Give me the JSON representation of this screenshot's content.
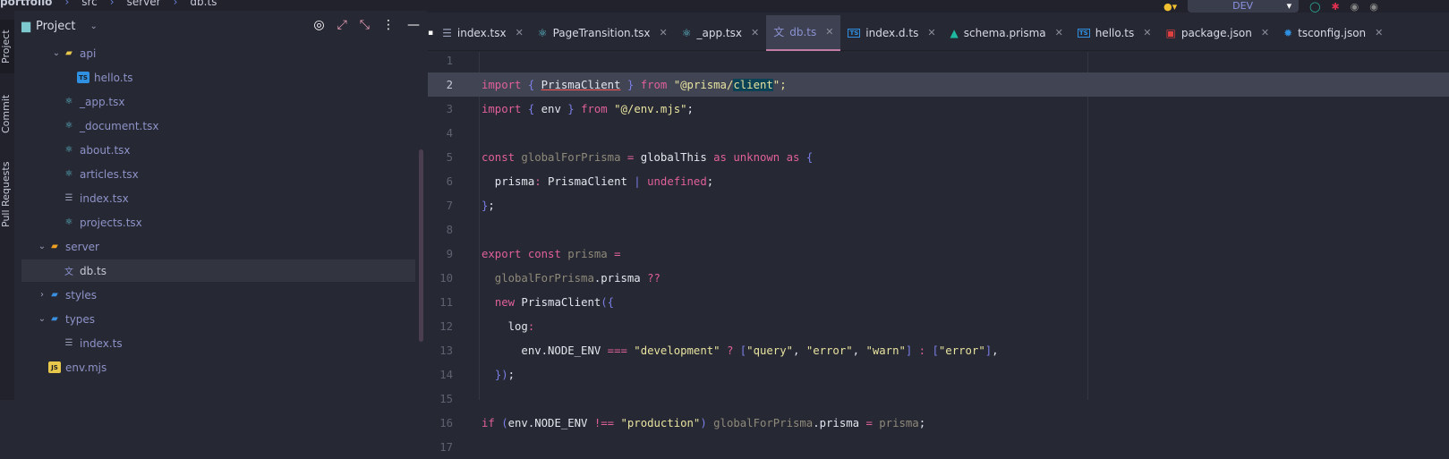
{
  "breadcrumb": [
    "portfolio",
    "src",
    "server",
    "db.ts"
  ],
  "toolbar": {
    "run_config": "DEV"
  },
  "vertical_tabs": [
    "Project",
    "Commit",
    "Pull Requests"
  ],
  "project": {
    "title": "Project",
    "tree": [
      {
        "label": "api",
        "type": "folder",
        "depth": 2,
        "open": true,
        "icon": "folder-api-icon",
        "color": "#e8c84a"
      },
      {
        "label": "hello.ts",
        "type": "file",
        "depth": 3,
        "icon": "typescript-icon",
        "color": "#2f8fe0"
      },
      {
        "label": "_app.tsx",
        "type": "file",
        "depth": 2,
        "icon": "react-icon",
        "color": "#5fc3d6"
      },
      {
        "label": "_document.tsx",
        "type": "file",
        "depth": 2,
        "icon": "react-icon",
        "color": "#5fc3d6"
      },
      {
        "label": "about.tsx",
        "type": "file",
        "depth": 2,
        "icon": "react-icon",
        "color": "#5fc3d6"
      },
      {
        "label": "articles.tsx",
        "type": "file",
        "depth": 2,
        "icon": "react-icon",
        "color": "#5fc3d6"
      },
      {
        "label": "index.tsx",
        "type": "file",
        "depth": 2,
        "icon": "list-icon",
        "color": "#9aa0b8"
      },
      {
        "label": "projects.tsx",
        "type": "file",
        "depth": 2,
        "icon": "react-icon",
        "color": "#5fc3d6"
      },
      {
        "label": "server",
        "type": "folder",
        "depth": 1,
        "open": true,
        "icon": "folder-server-icon",
        "color": "#f0a020"
      },
      {
        "label": "db.ts",
        "type": "file",
        "depth": 2,
        "icon": "translate-icon",
        "color": "#8b92d0",
        "selected": true
      },
      {
        "label": "styles",
        "type": "folder",
        "depth": 1,
        "open": false,
        "icon": "folder-styles-icon",
        "color": "#3a8fe0"
      },
      {
        "label": "types",
        "type": "folder",
        "depth": 1,
        "open": true,
        "icon": "folder-types-icon",
        "color": "#3a8fe0"
      },
      {
        "label": "index.ts",
        "type": "file",
        "depth": 2,
        "icon": "list-icon",
        "color": "#9aa0b8"
      },
      {
        "label": "env.mjs",
        "type": "file",
        "depth": 1,
        "icon": "javascript-icon",
        "color": "#e8c84a"
      }
    ]
  },
  "tabs": [
    {
      "label": "index.tsx",
      "icon": "list-icon",
      "glyph": "☰",
      "color": "#9aa0b8"
    },
    {
      "label": "PageTransition.tsx",
      "icon": "react-icon",
      "glyph": "⚛",
      "color": "#5fc3d6"
    },
    {
      "label": "_app.tsx",
      "icon": "react-icon",
      "glyph": "⚛",
      "color": "#5fc3d6"
    },
    {
      "label": "db.ts",
      "icon": "translate-icon",
      "glyph": "文",
      "color": "#8b92d0",
      "active": true
    },
    {
      "label": "index.d.ts",
      "icon": "typescript-icon",
      "glyph": "TS",
      "color": "#2f8fe0"
    },
    {
      "label": "schema.prisma",
      "icon": "prisma-icon",
      "glyph": "▲",
      "color": "#1fb8a0"
    },
    {
      "label": "hello.ts",
      "icon": "typescript-icon",
      "glyph": "TS",
      "color": "#2f8fe0"
    },
    {
      "label": "package.json",
      "icon": "npm-icon",
      "glyph": "▣",
      "color": "#e04040"
    },
    {
      "label": "tsconfig.json",
      "icon": "tsconfig-icon",
      "glyph": "✹",
      "color": "#2f8fe0"
    }
  ],
  "editor": {
    "current_line": 2,
    "lines": [
      [],
      [
        [
          "import",
          "kw"
        ],
        [
          " ",
          "pn"
        ],
        [
          "{",
          "br"
        ],
        [
          " ",
          "pn"
        ],
        [
          "PrismaClient",
          "id ul"
        ],
        [
          " ",
          "pn"
        ],
        [
          "}",
          "br"
        ],
        [
          " ",
          "pn"
        ],
        [
          "from",
          "kw"
        ],
        [
          " \"@prisma/",
          "st"
        ],
        [
          "client",
          "st hl"
        ],
        [
          "\";",
          "st"
        ]
      ],
      [
        [
          "import",
          "kw"
        ],
        [
          " ",
          "pn"
        ],
        [
          "{",
          "br"
        ],
        [
          " env ",
          "id"
        ],
        [
          "}",
          "br"
        ],
        [
          " ",
          "pn"
        ],
        [
          "from",
          "kw"
        ],
        [
          " \"@/env.mjs\"",
          "st"
        ],
        [
          ";",
          "pn"
        ]
      ],
      [],
      [
        [
          "const",
          "kw"
        ],
        [
          " globalForPrisma ",
          "va"
        ],
        [
          "=",
          "op"
        ],
        [
          " globalThis ",
          "id"
        ],
        [
          "as",
          "kw"
        ],
        [
          " ",
          "pn"
        ],
        [
          "unknown",
          "kw"
        ],
        [
          " ",
          "pn"
        ],
        [
          "as",
          "kw"
        ],
        [
          " ",
          "pn"
        ],
        [
          "{",
          "br"
        ]
      ],
      [
        [
          "  prisma",
          "id"
        ],
        [
          ":",
          "op"
        ],
        [
          " PrismaClient ",
          "id"
        ],
        [
          "|",
          "br"
        ],
        [
          " ",
          "pn"
        ],
        [
          "undefined",
          "kw"
        ],
        [
          ";",
          "pn"
        ]
      ],
      [
        [
          "}",
          "br"
        ],
        [
          ";",
          "pn"
        ]
      ],
      [],
      [
        [
          "export",
          "kw"
        ],
        [
          " ",
          "pn"
        ],
        [
          "const",
          "kw"
        ],
        [
          " prisma ",
          "va"
        ],
        [
          "=",
          "op"
        ]
      ],
      [
        [
          "  globalForPrisma",
          "va"
        ],
        [
          ".prisma ",
          "id"
        ],
        [
          "??",
          "op"
        ]
      ],
      [
        [
          "  ",
          "pn"
        ],
        [
          "new",
          "kw"
        ],
        [
          " PrismaClient",
          "id"
        ],
        [
          "({",
          "br"
        ]
      ],
      [
        [
          "    log",
          "id"
        ],
        [
          ":",
          "op"
        ]
      ],
      [
        [
          "      env.NODE_ENV ",
          "id"
        ],
        [
          "===",
          "op"
        ],
        [
          " \"development\"",
          "st"
        ],
        [
          " ? ",
          "op"
        ],
        [
          "[",
          "br"
        ],
        [
          "\"query\"",
          "st"
        ],
        [
          ", ",
          "pn"
        ],
        [
          "\"error\"",
          "st"
        ],
        [
          ", ",
          "pn"
        ],
        [
          "\"warn\"",
          "st"
        ],
        [
          "]",
          "br"
        ],
        [
          " : ",
          "op"
        ],
        [
          "[",
          "br"
        ],
        [
          "\"error\"",
          "st"
        ],
        [
          "]",
          "br"
        ],
        [
          ",",
          "pn"
        ]
      ],
      [
        [
          "  ",
          "pn"
        ],
        [
          "})",
          "br"
        ],
        [
          ";",
          "pn"
        ]
      ],
      [],
      [
        [
          "if",
          "kw"
        ],
        [
          " ",
          "pn"
        ],
        [
          "(",
          "br"
        ],
        [
          "env.NODE_ENV ",
          "id"
        ],
        [
          "!==",
          "op"
        ],
        [
          " \"production\"",
          "st"
        ],
        [
          ")",
          "br"
        ],
        [
          " globalForPrisma",
          "va"
        ],
        [
          ".prisma ",
          "id"
        ],
        [
          "=",
          "op"
        ],
        [
          " prisma",
          "va"
        ],
        [
          ";",
          "pn"
        ]
      ],
      []
    ]
  }
}
